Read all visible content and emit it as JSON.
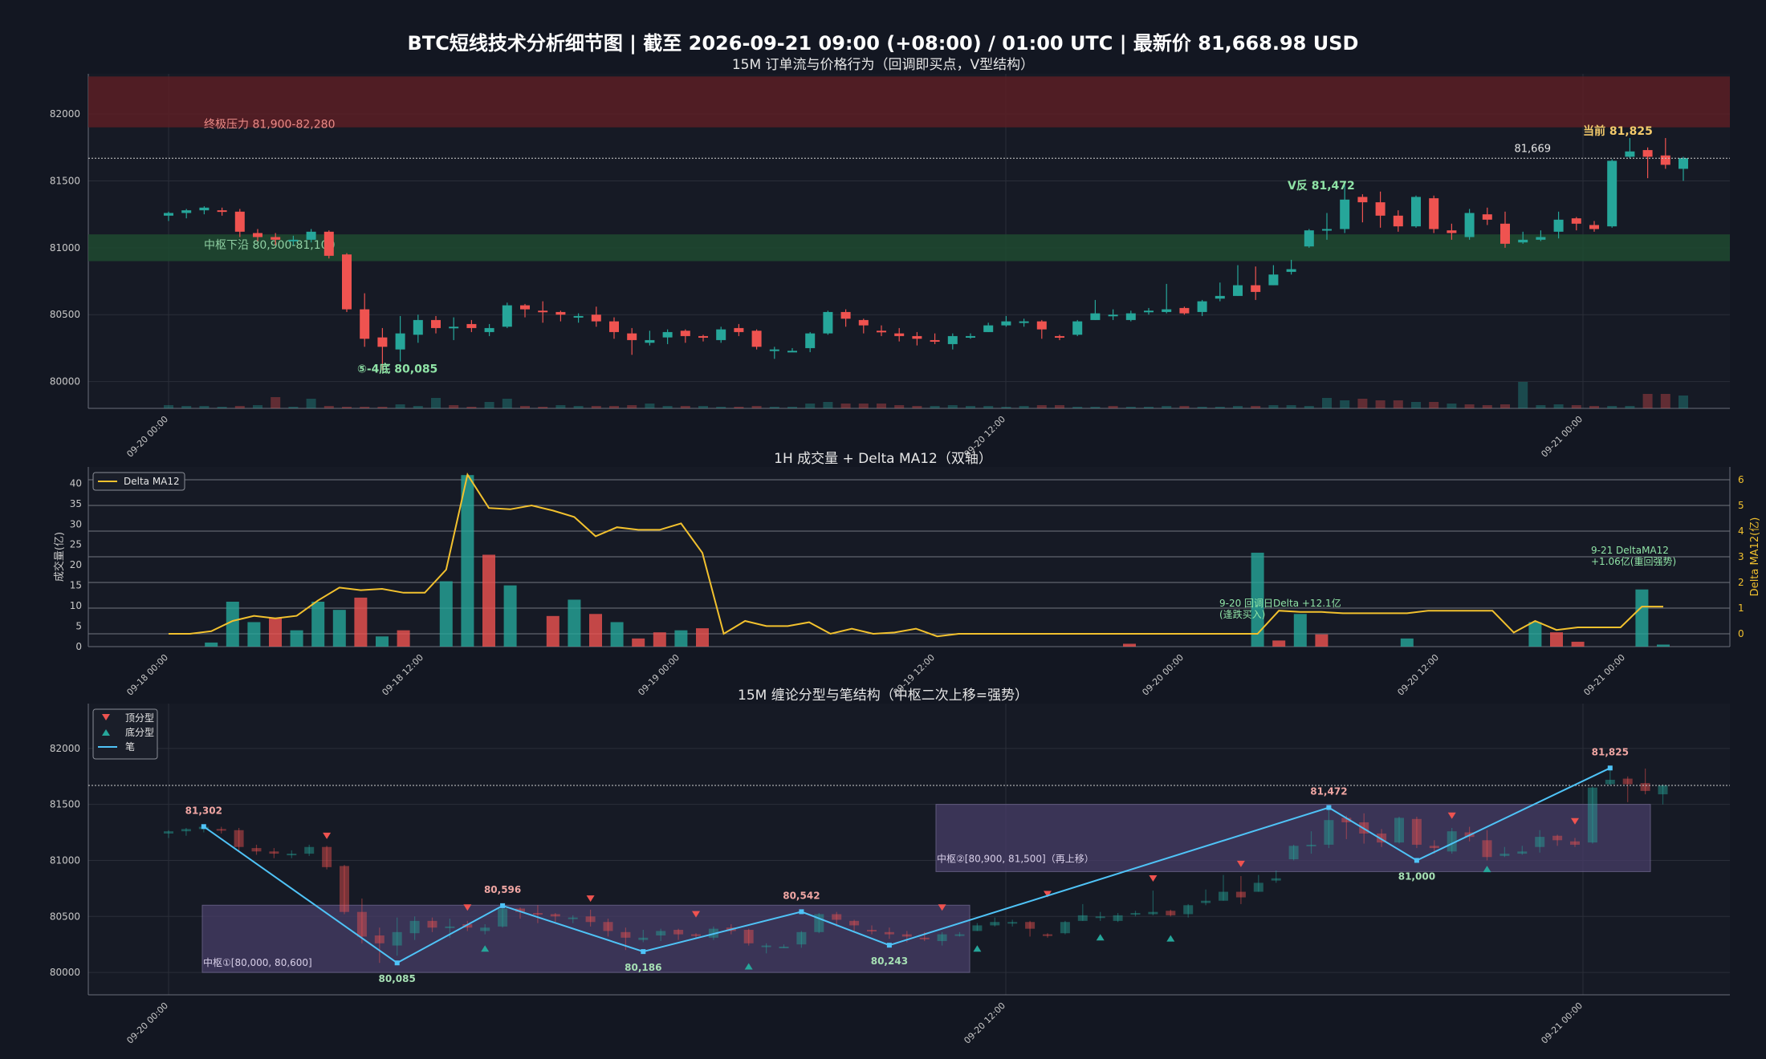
{
  "figure": {
    "suptitle": "BTC短线技术分析细节图  |  截至 2026-09-21 09:00 (+08:00) / 01:00 UTC  |  最新价 81,668.98 USD"
  },
  "colors": {
    "bg": "#131722",
    "panel_bg": "#161a25",
    "up": "#26a69a",
    "down": "#ef5350",
    "delta_line": "#f2c12e",
    "bi_line": "#4fc3f7",
    "zs_fill": "#4a3f6b",
    "resist_fill": "#5a1e24",
    "support_fill": "#1e4a30"
  },
  "chart_data": [
    {
      "type": "candlestick",
      "title": "15M 订单流与价格行为（回调即买点，V型结构）",
      "x_ticks": [
        "09-20 00:00",
        "09-20 12:00",
        "09-21 00:00"
      ],
      "ylim": [
        79800,
        82300
      ],
      "y_ticks": [
        80000,
        80500,
        81000,
        81500,
        82000
      ],
      "grid": true,
      "last_price_line": 81669,
      "last_price_label": "81,669",
      "zones": [
        {
          "label": "终极压力 81,900-82,280",
          "low": 81900,
          "high": 82280,
          "color": "#5a1e24"
        },
        {
          "label": "中枢下沿 80,900-81,100",
          "low": 80900,
          "high": 81100,
          "color": "#1e4a30"
        }
      ],
      "annotations": [
        {
          "text": "⑤-4底 80,085",
          "price": 80085
        },
        {
          "text": "V反 81,472",
          "price": 81472
        },
        {
          "text": "当前 81,825",
          "price": 81825
        }
      ],
      "candles": [
        [
          81240,
          81260,
          81200,
          81270
        ],
        [
          81260,
          81280,
          81220,
          81290
        ],
        [
          81280,
          81300,
          81250,
          81310
        ],
        [
          81280,
          81270,
          81240,
          81300
        ],
        [
          81270,
          81120,
          81080,
          81290
        ],
        [
          81110,
          81080,
          81050,
          81140
        ],
        [
          81080,
          81060,
          81020,
          81110
        ],
        [
          81050,
          81060,
          81020,
          81090
        ],
        [
          81060,
          81120,
          81040,
          81140
        ],
        [
          81120,
          80940,
          80920,
          81130
        ],
        [
          80950,
          80540,
          80520,
          80960
        ],
        [
          80540,
          80320,
          80260,
          80660
        ],
        [
          80330,
          80260,
          80085,
          80400
        ],
        [
          80240,
          80360,
          80150,
          80490
        ],
        [
          80350,
          80460,
          80290,
          80500
        ],
        [
          80460,
          80400,
          80360,
          80490
        ],
        [
          80410,
          80410,
          80310,
          80480
        ],
        [
          80430,
          80400,
          80370,
          80460
        ],
        [
          80370,
          80400,
          80340,
          80430
        ],
        [
          80410,
          80570,
          80400,
          80590
        ],
        [
          80570,
          80540,
          80480,
          80580
        ],
        [
          80530,
          80520,
          80440,
          80600
        ],
        [
          80520,
          80500,
          80450,
          80530
        ],
        [
          80480,
          80490,
          80440,
          80510
        ],
        [
          80500,
          80450,
          80410,
          80560
        ],
        [
          80450,
          80370,
          80320,
          80480
        ],
        [
          80360,
          80310,
          80200,
          80400
        ],
        [
          80290,
          80310,
          80270,
          80380
        ],
        [
          80330,
          80370,
          80280,
          80390
        ],
        [
          80380,
          80340,
          80290,
          80390
        ],
        [
          80340,
          80330,
          80300,
          80350
        ],
        [
          80310,
          80390,
          80290,
          80410
        ],
        [
          80400,
          80370,
          80340,
          80430
        ],
        [
          80380,
          80260,
          80240,
          80390
        ],
        [
          80240,
          80240,
          80170,
          80260
        ],
        [
          80230,
          80230,
          80220,
          80250
        ],
        [
          80250,
          80360,
          80220,
          80370
        ],
        [
          80360,
          80520,
          80350,
          80530
        ],
        [
          80520,
          80470,
          80410,
          80540
        ],
        [
          80460,
          80420,
          80360,
          80470
        ],
        [
          80380,
          80370,
          80340,
          80420
        ],
        [
          80360,
          80340,
          80300,
          80400
        ],
        [
          80340,
          80320,
          80270,
          80370
        ],
        [
          80310,
          80300,
          80280,
          80360
        ],
        [
          80280,
          80340,
          80240,
          80360
        ],
        [
          80340,
          80340,
          80320,
          80360
        ],
        [
          80370,
          80420,
          80370,
          80440
        ],
        [
          80420,
          80450,
          80410,
          80490
        ],
        [
          80440,
          80450,
          80410,
          80470
        ],
        [
          80450,
          80390,
          80320,
          80460
        ],
        [
          80340,
          80330,
          80310,
          80350
        ],
        [
          80350,
          80450,
          80340,
          80460
        ],
        [
          80460,
          80510,
          80460,
          80610
        ],
        [
          80500,
          80500,
          80460,
          80540
        ],
        [
          80460,
          80510,
          80450,
          80530
        ],
        [
          80530,
          80530,
          80500,
          80550
        ],
        [
          80520,
          80540,
          80510,
          80730
        ],
        [
          80550,
          80510,
          80500,
          80560
        ],
        [
          80520,
          80600,
          80490,
          80610
        ],
        [
          80620,
          80640,
          80600,
          80740
        ],
        [
          80640,
          80720,
          80640,
          80870
        ],
        [
          80720,
          80670,
          80610,
          80860
        ],
        [
          80720,
          80800,
          80720,
          80870
        ],
        [
          80820,
          80840,
          80800,
          80910
        ],
        [
          81010,
          81130,
          81000,
          81140
        ],
        [
          81140,
          81140,
          81060,
          81260
        ],
        [
          81140,
          81360,
          81110,
          81470
        ],
        [
          81380,
          81340,
          81190,
          81400
        ],
        [
          81340,
          81240,
          81150,
          81420
        ],
        [
          81240,
          81160,
          81120,
          81280
        ],
        [
          81160,
          81380,
          81150,
          81390
        ],
        [
          81370,
          81140,
          81110,
          81390
        ],
        [
          81130,
          81110,
          81060,
          81180
        ],
        [
          81080,
          81260,
          81060,
          81290
        ],
        [
          81250,
          81210,
          81170,
          81300
        ],
        [
          81180,
          81030,
          81000,
          81270
        ],
        [
          81040,
          81060,
          81030,
          81120
        ],
        [
          81060,
          81080,
          81050,
          81130
        ],
        [
          81120,
          81210,
          81070,
          81270
        ],
        [
          81220,
          81180,
          81130,
          81230
        ],
        [
          81170,
          81140,
          81120,
          81200
        ],
        [
          81160,
          81650,
          81150,
          81660
        ],
        [
          81680,
          81720,
          81670,
          81820
        ],
        [
          81730,
          81680,
          81520,
          81750
        ],
        [
          81690,
          81620,
          81590,
          81820
        ],
        [
          81590,
          81670,
          81500,
          81680
        ]
      ],
      "volume_bars": [
        "u",
        "u",
        "u",
        "u",
        "d",
        "u",
        "d",
        "u",
        "u",
        "d",
        "d",
        "d",
        "d",
        "u",
        "u",
        "u",
        "d",
        "d",
        "u",
        "u",
        "d",
        "d",
        "u",
        "u",
        "d",
        "d",
        "d",
        "u",
        "u",
        "d",
        "u",
        "u",
        "d",
        "d",
        "u",
        "u",
        "u",
        "u",
        "d",
        "d",
        "d",
        "d",
        "d",
        "u",
        "u",
        "u",
        "u",
        "u",
        "u",
        "d",
        "d",
        "u",
        "u",
        "d",
        "u",
        "u",
        "u",
        "d",
        "u",
        "u",
        "u",
        "d",
        "u",
        "u",
        "u",
        "u",
        "u",
        "d",
        "d",
        "d",
        "u",
        "d",
        "u",
        "d",
        "d",
        "d",
        "u",
        "u",
        "u",
        "d",
        "d",
        "u",
        "u",
        "d",
        "d",
        "u"
      ]
    },
    {
      "type": "bar+line",
      "title": "1H 成交量 + Delta MA12（双轴）",
      "ylabel": "成交量(亿)",
      "ylabel_right": "Delta MA12(亿)",
      "x_ticks": [
        "09-18 00:00",
        "09-18 12:00",
        "09-19 00:00",
        "09-19 12:00",
        "09-20 00:00",
        "09-20 12:00",
        "09-21 00:00"
      ],
      "ylim": [
        0,
        44
      ],
      "y_ticks": [
        0,
        5,
        10,
        15,
        20,
        25,
        30,
        35,
        40
      ],
      "ylim_right": [
        -0.5,
        6.5
      ],
      "y_ticks_right": [
        0,
        1,
        2,
        3,
        4,
        5,
        6
      ],
      "legend": {
        "entries": [
          "Delta MA12"
        ],
        "position": "top-left"
      },
      "annotations": [
        {
          "text": "9-20 回调日Delta +12.1亿\n(逢跌买入)"
        },
        {
          "text": "9-21 DeltaMA12\n+1.06亿(重回强势)"
        }
      ],
      "volume": [
        {
          "i": 2,
          "v": 1.0,
          "dir": "u"
        },
        {
          "i": 3,
          "v": 11.0,
          "dir": "u"
        },
        {
          "i": 4,
          "v": 6.0,
          "dir": "u"
        },
        {
          "i": 5,
          "v": 7.0,
          "dir": "d"
        },
        {
          "i": 6,
          "v": 4.0,
          "dir": "u"
        },
        {
          "i": 7,
          "v": 11.0,
          "dir": "u"
        },
        {
          "i": 8,
          "v": 9.0,
          "dir": "u"
        },
        {
          "i": 9,
          "v": 12.0,
          "dir": "d"
        },
        {
          "i": 10,
          "v": 2.5,
          "dir": "u"
        },
        {
          "i": 11,
          "v": 4.0,
          "dir": "d"
        },
        {
          "i": 13,
          "v": 16.0,
          "dir": "u"
        },
        {
          "i": 14,
          "v": 42.0,
          "dir": "u"
        },
        {
          "i": 15,
          "v": 22.5,
          "dir": "d"
        },
        {
          "i": 16,
          "v": 15.0,
          "dir": "u"
        },
        {
          "i": 18,
          "v": 7.5,
          "dir": "d"
        },
        {
          "i": 19,
          "v": 11.5,
          "dir": "u"
        },
        {
          "i": 20,
          "v": 8.0,
          "dir": "d"
        },
        {
          "i": 21,
          "v": 6.0,
          "dir": "u"
        },
        {
          "i": 22,
          "v": 2.0,
          "dir": "d"
        },
        {
          "i": 23,
          "v": 3.5,
          "dir": "d"
        },
        {
          "i": 24,
          "v": 4.0,
          "dir": "u"
        },
        {
          "i": 25,
          "v": 4.5,
          "dir": "d"
        },
        {
          "i": 45,
          "v": 0.7,
          "dir": "d"
        },
        {
          "i": 51,
          "v": 23.0,
          "dir": "u"
        },
        {
          "i": 52,
          "v": 1.5,
          "dir": "d"
        },
        {
          "i": 53,
          "v": 8.0,
          "dir": "u"
        },
        {
          "i": 54,
          "v": 3.0,
          "dir": "d"
        },
        {
          "i": 58,
          "v": 2.0,
          "dir": "u"
        },
        {
          "i": 64,
          "v": 6.0,
          "dir": "u"
        },
        {
          "i": 65,
          "v": 3.5,
          "dir": "d"
        },
        {
          "i": 66,
          "v": 1.2,
          "dir": "d"
        },
        {
          "i": 69,
          "v": 14.0,
          "dir": "u"
        },
        {
          "i": 70,
          "v": 0.5,
          "dir": "u"
        }
      ],
      "delta_ma12": [
        0,
        0,
        0.1,
        0.5,
        0.7,
        0.6,
        0.7,
        1.3,
        1.8,
        1.7,
        1.75,
        1.6,
        1.6,
        2.5,
        6.2,
        4.9,
        4.85,
        5.0,
        4.8,
        4.55,
        3.8,
        4.15,
        4.05,
        4.05,
        4.3,
        3.15,
        0.0,
        0.5,
        0.3,
        0.3,
        0.45,
        0.0,
        0.2,
        0.0,
        0.05,
        0.2,
        -0.1,
        0.0,
        0.0,
        0.0,
        0.0,
        0.0,
        0.0,
        0.0,
        0.0,
        0.0,
        0.0,
        0.0,
        0.0,
        0.0,
        0.0,
        0.0,
        0.9,
        0.85,
        0.85,
        0.8,
        0.8,
        0.8,
        0.8,
        0.9,
        0.9,
        0.9,
        0.9,
        0.05,
        0.5,
        0.15,
        0.25,
        0.25,
        0.25,
        1.06,
        1.06
      ]
    },
    {
      "type": "candlestick+structure",
      "title": "15M 缠论分型与笔结构（中枢二次上移=强势）",
      "x_ticks": [
        "09-20 00:00",
        "09-20 12:00",
        "09-21 00:00"
      ],
      "ylim": [
        79800,
        82400
      ],
      "y_ticks": [
        80000,
        80500,
        81000,
        81500,
        82000
      ],
      "grid": true,
      "last_price_line": 81669,
      "legend": {
        "entries": [
          "顶分型",
          "底分型",
          "笔"
        ],
        "position": "top-left"
      },
      "zhongshu": [
        {
          "label": "中枢①[80,000, 80,600]",
          "low": 80000,
          "high": 80600
        },
        {
          "label": "中枢②[80,900, 81,500]（再上移）",
          "low": 80900,
          "high": 81500
        }
      ],
      "bi_points": [
        {
          "idx": 2,
          "price": 81302,
          "label": "81,302",
          "kind": "top"
        },
        {
          "idx": 13,
          "price": 80085,
          "label": "80,085",
          "kind": "bottom"
        },
        {
          "idx": 19,
          "price": 80596,
          "label": "80,596",
          "kind": "top"
        },
        {
          "idx": 27,
          "price": 80186,
          "label": "80,186",
          "kind": "bottom"
        },
        {
          "idx": 36,
          "price": 80542,
          "label": "80,542",
          "kind": "top"
        },
        {
          "idx": 41,
          "price": 80243,
          "label": "80,243",
          "kind": "bottom"
        },
        {
          "idx": 66,
          "price": 81472,
          "label": "81,472",
          "kind": "top"
        },
        {
          "idx": 71,
          "price": 81000,
          "label": "81,000",
          "kind": "bottom"
        },
        {
          "idx": 82,
          "price": 81825,
          "label": "81,825",
          "kind": "top"
        }
      ],
      "fractals_top": [
        [
          9,
          81140
        ],
        [
          17,
          80500
        ],
        [
          24,
          80580
        ],
        [
          30,
          80440
        ],
        [
          44,
          80500
        ],
        [
          50,
          80620
        ],
        [
          56,
          80760
        ],
        [
          61,
          80890
        ],
        [
          73,
          81320
        ],
        [
          80,
          81270
        ]
      ],
      "fractals_bottom": [
        [
          18,
          80300
        ],
        [
          33,
          80140
        ],
        [
          46,
          80300
        ],
        [
          53,
          80400
        ],
        [
          57,
          80390
        ],
        [
          75,
          81010
        ]
      ]
    }
  ]
}
